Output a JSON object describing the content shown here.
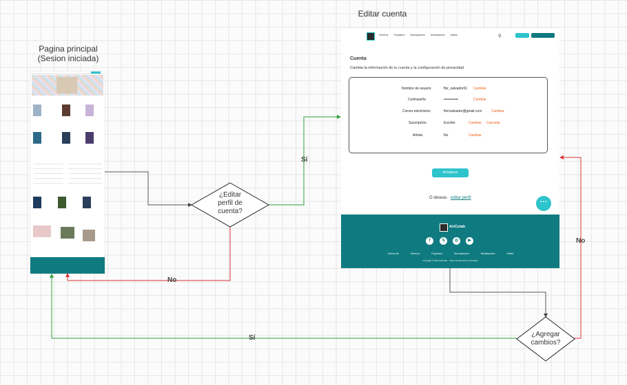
{
  "titles": {
    "main": "Pagina principal\n(Sesion iniciada)",
    "edit": "Editar cuenta"
  },
  "decisions": {
    "edit_profile": "¿Editar\nperfil de\ncuenta?",
    "add_changes": "¿Agregar\ncambios?"
  },
  "edges": {
    "yes1": "Sí",
    "no1": "No",
    "yes2": "Sí",
    "no2": "No"
  },
  "colors": {
    "teal": "#0f7b80",
    "accent": "#2ec4cc",
    "orange": "#e8631a",
    "yes_line": "#2e9e3a",
    "no_line": "#d33"
  },
  "account_page": {
    "nav": [
      "Géneros",
      "Populares",
      "Suscripciones",
      "Monetización",
      "Artista"
    ],
    "heading": "Cuenta",
    "subheading": "Cambia la información de tu cuenta y la configuración de privacidad",
    "rows": [
      {
        "label": "Nombre de usuario",
        "value": "flor_salvador01",
        "actions": [
          "Cambiar"
        ]
      },
      {
        "label": "Contraseña",
        "value": "••••••••••••",
        "actions": [
          "Cambiar"
        ]
      },
      {
        "label": "Correo electrónico",
        "value": "florrsalvador@gmail.com",
        "actions": [
          "Cambiar"
        ]
      },
      {
        "label": "Suscripción",
        "value": "Escritor",
        "actions": [
          "Cambiar",
          "Cancelar"
        ]
      },
      {
        "label": "Artista",
        "value": "No",
        "actions": [
          "Cambiar"
        ]
      }
    ],
    "update_button": "Actualizar",
    "delete_prompt": "O deseas",
    "delete_link": "editar perfil",
    "footer_brand": "ArtColab",
    "footer_links": [
      "Acerca de",
      "Géneros",
      "Populares",
      "Suscripciones",
      "Monetización",
      "Artista"
    ],
    "footer_copy": "Copyright © 2024 ArtColab – Todos los derechos reservados"
  }
}
